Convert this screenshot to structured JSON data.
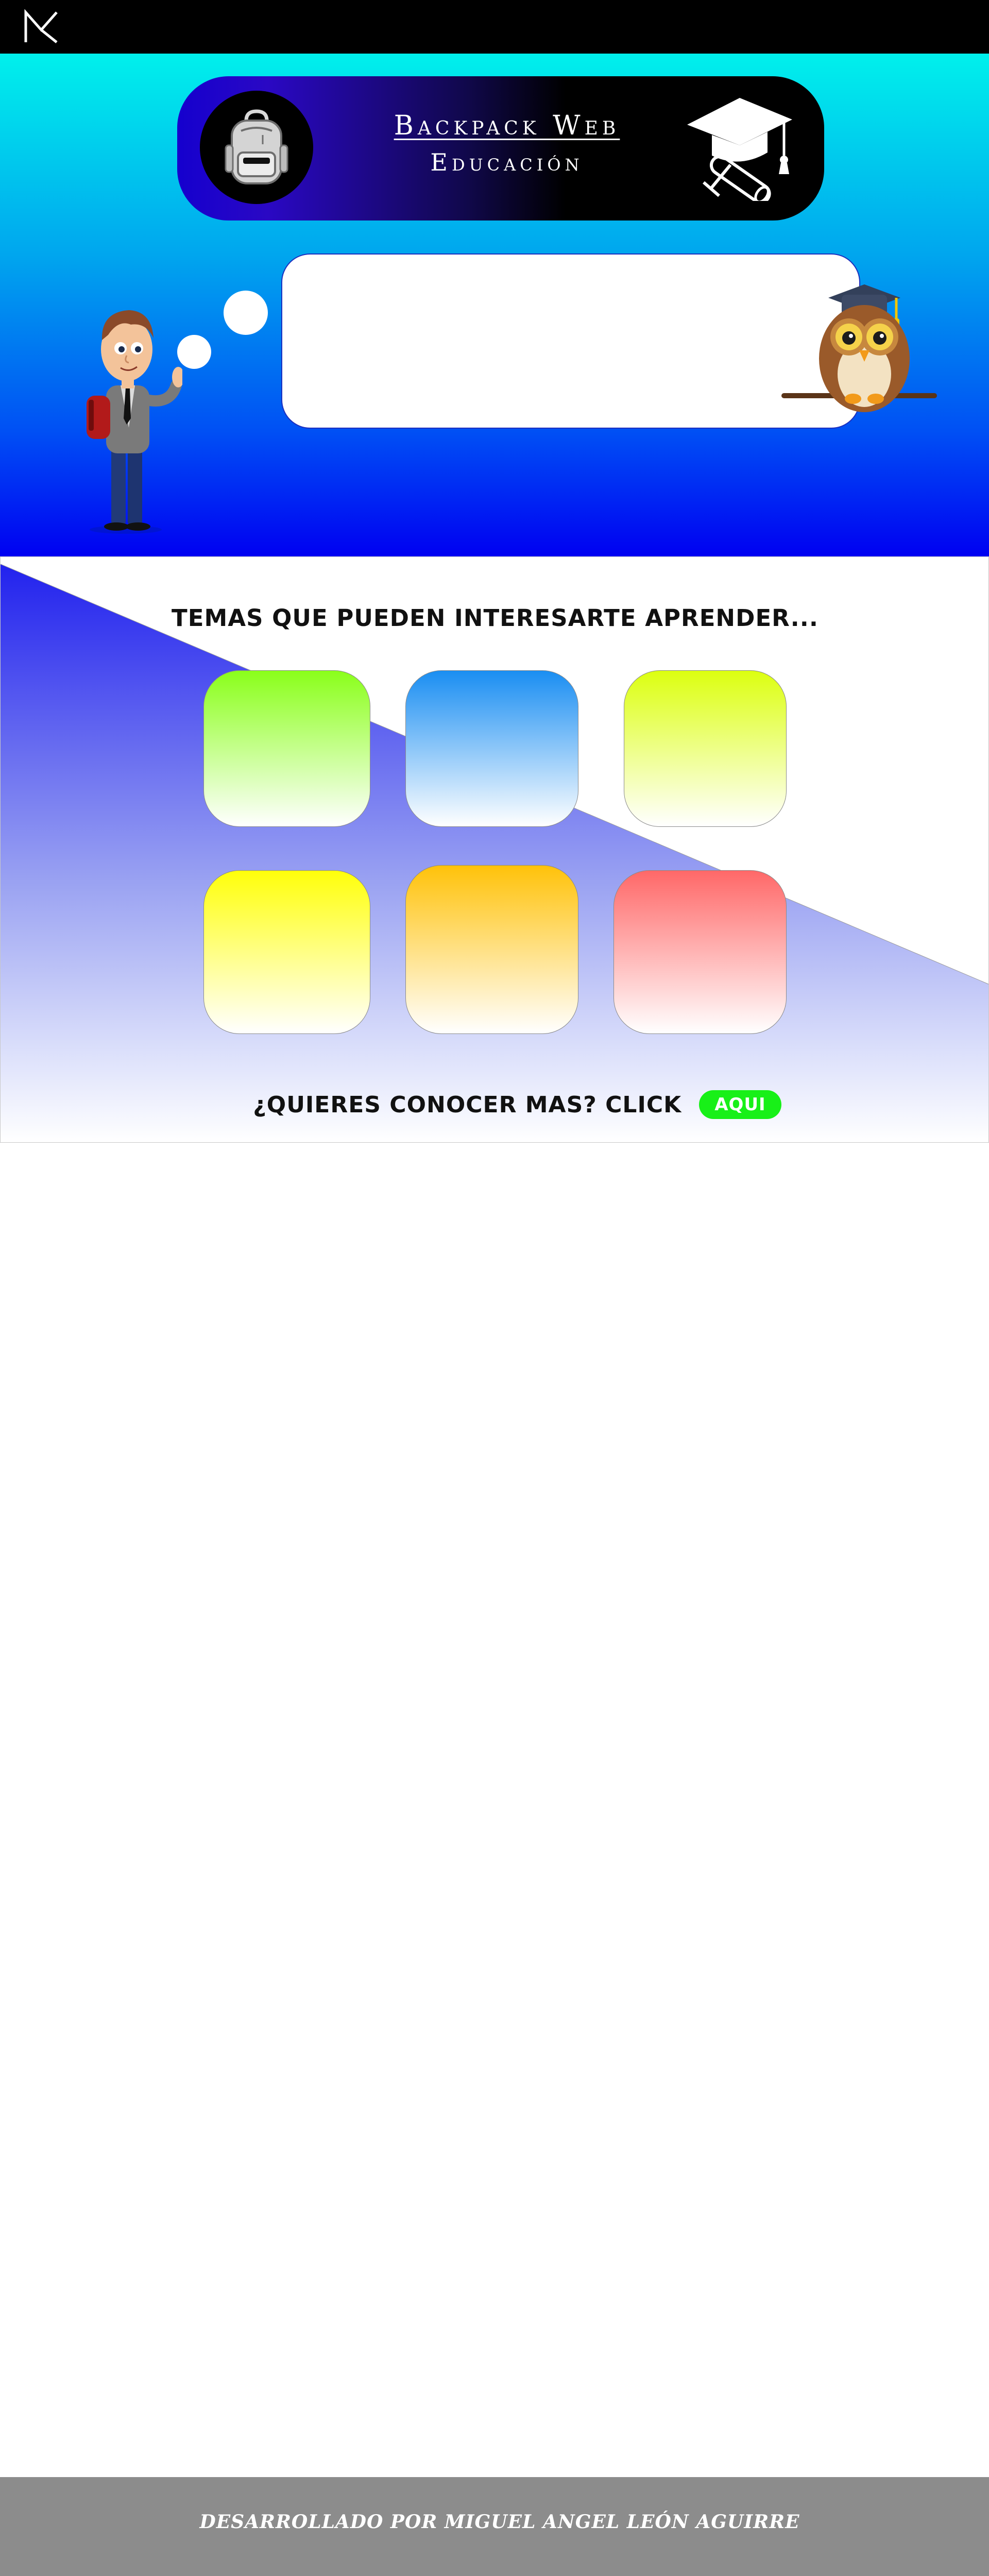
{
  "brand": {
    "logo_icon": "m-monogram-icon"
  },
  "banner": {
    "title": "Backpack Web",
    "subtitle": "Educación",
    "icons": [
      "backpack-icon",
      "graduation-cap-diploma-icon"
    ]
  },
  "hero": {
    "bubble_text": "",
    "illustrations": [
      "student-illustration",
      "owl-illustration"
    ]
  },
  "topics": {
    "heading": "TEMAS QUE PUEDEN INTERESARTE APRENDER...",
    "tiles": [
      {
        "label": "",
        "color": "#8aff1a"
      },
      {
        "label": "",
        "color": "#1a8ef2"
      },
      {
        "label": "",
        "color": "#dcff10"
      },
      {
        "label": "",
        "color": "#ffff0a"
      },
      {
        "label": "",
        "color": "#ffc20a"
      },
      {
        "label": "",
        "color": "#ff6868"
      }
    ]
  },
  "cta": {
    "text": "¿QUIERES CONOCER MAS? CLICK",
    "button_label": "AQUI",
    "button_color": "#18f018"
  },
  "footer": {
    "credit": "DESARROLLADO POR MIGUEL ANGEL LEÓN AGUIRRE"
  },
  "colors": {
    "topbar": "#000000",
    "hero_top": "#00f0ec",
    "hero_bottom": "#0000f2",
    "footer": "#8c8c8c"
  }
}
